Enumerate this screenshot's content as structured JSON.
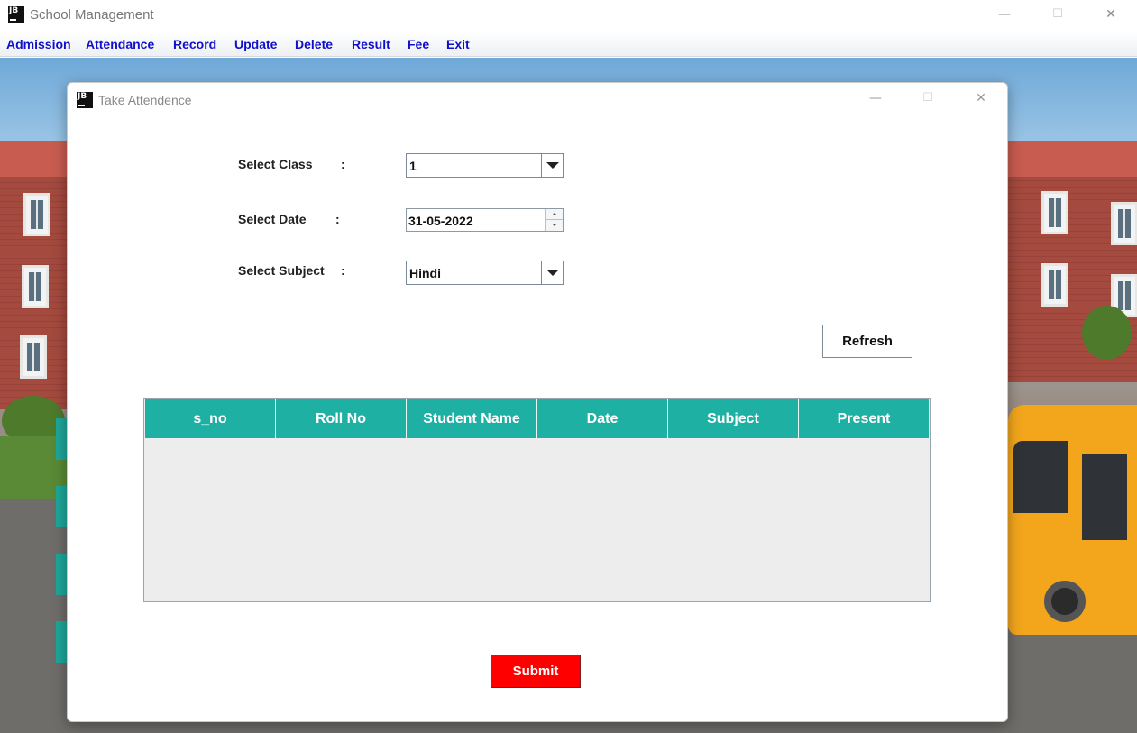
{
  "window": {
    "logo_text": "JB",
    "title": "School Management",
    "controls": {
      "minimize": "—",
      "maximize": "☐",
      "close": "✕"
    }
  },
  "menu": {
    "items": [
      {
        "label": "Admission"
      },
      {
        "label": "Attendance"
      },
      {
        "label": "Record"
      },
      {
        "label": "Update"
      },
      {
        "label": "Delete"
      },
      {
        "label": "Result"
      },
      {
        "label": "Fee"
      },
      {
        "label": "Exit"
      }
    ]
  },
  "dialog": {
    "logo_text": "JB",
    "title": "Take Attendence",
    "controls": {
      "minimize": "—",
      "maximize": "☐",
      "close": "✕"
    },
    "form": {
      "class": {
        "label": "Select Class",
        "colon": ":",
        "value": "1"
      },
      "date": {
        "label": "Select Date",
        "colon": ":",
        "value": "31-05-2022"
      },
      "subject": {
        "label": "Select Subject",
        "colon": ":",
        "value": "Hindi"
      }
    },
    "refresh_label": "Refresh",
    "table": {
      "columns": [
        "s_no",
        "Roll No",
        "Student Name",
        "Date",
        "Subject",
        "Present"
      ],
      "rows": [],
      "header_color": "#1fb0a4"
    },
    "submit_label": "Submit",
    "submit_color": "#ff0000"
  }
}
